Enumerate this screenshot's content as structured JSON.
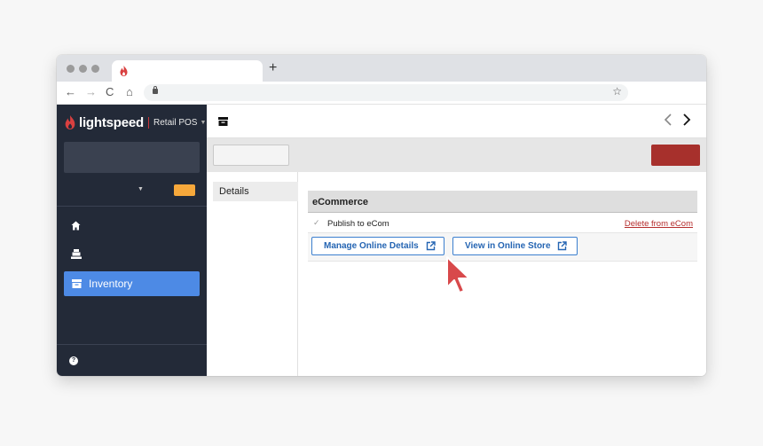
{
  "browser": {
    "new_tab_symbol": "+",
    "nav": {
      "back": "←",
      "forward": "→",
      "reload": "C",
      "home": "⌂"
    },
    "star": "☆",
    "icons": [
      "flame-icon",
      "lock-icon",
      "star-icon"
    ]
  },
  "app": {
    "brand": "lightspeed",
    "product": "Retail POS",
    "product_caret": "▼",
    "user_caret": "▼",
    "nav_items": [
      {
        "icon": "home-icon"
      },
      {
        "icon": "register-icon"
      },
      {
        "icon": "inventory-icon",
        "label": "Inventory",
        "active": true
      }
    ],
    "help_symbol": "?",
    "top_nav": {
      "prev": "〈",
      "next": "〉"
    },
    "colors": {
      "sidebar": "#232a38",
      "accent": "#4d8ae5",
      "brand_red": "#d94040",
      "badge": "#f6a83b",
      "danger": "#a7302c"
    }
  },
  "tabs": [
    {
      "label": "Details",
      "active": true
    }
  ],
  "ecommerce": {
    "heading": "eCommerce",
    "publish_check": "✓",
    "publish_label": "Publish to eCom",
    "delete_link": "Delete from eCom",
    "manage_button": "Manage Online Details",
    "view_button": "View in Online Store"
  }
}
